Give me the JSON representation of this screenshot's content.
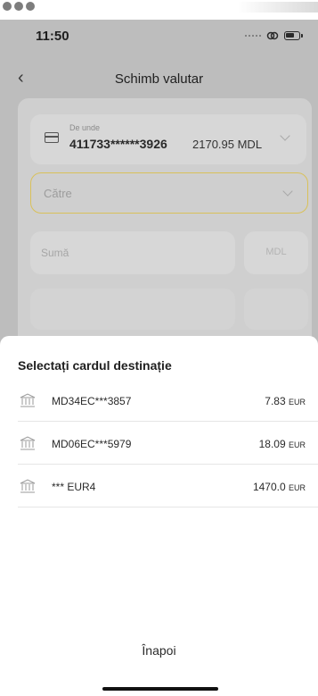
{
  "status_bar": {
    "time": "11:50",
    "icons": [
      "signal-dots-icon",
      "link-icon",
      "battery-icon"
    ]
  },
  "header": {
    "back_icon": "‹",
    "title": "Schimb valutar"
  },
  "form": {
    "source": {
      "label": "De unde",
      "card_number": "411733******3926",
      "balance": "2170.95 MDL"
    },
    "to_label": "Către",
    "amount_placeholder": "Sumă",
    "currency": "MDL"
  },
  "sheet": {
    "title": "Selectați cardul destinație",
    "accounts": [
      {
        "name": "MD34EC***3857",
        "amount": "7.83",
        "currency": "EUR"
      },
      {
        "name": "MD06EC***5979",
        "amount": "18.09",
        "currency": "EUR"
      },
      {
        "name": "*** EUR4",
        "amount": "1470.0",
        "currency": "EUR"
      }
    ],
    "back_label": "Înapoi"
  },
  "colors": {
    "overlay": "#bdbdbd",
    "accent_border": "#d9c15a",
    "sheet_bg": "#ffffff"
  }
}
